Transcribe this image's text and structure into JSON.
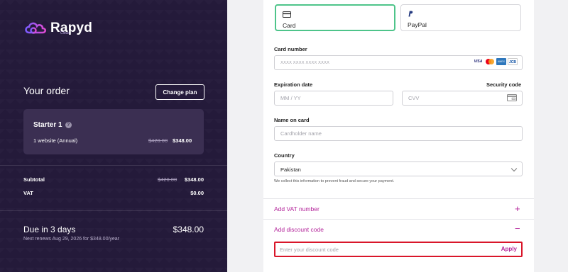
{
  "brand": {
    "name": "Rapyd",
    "sub": "Cloud"
  },
  "order": {
    "title": "Your order",
    "change_plan_label": "Change plan",
    "plan": {
      "name": "Starter 1",
      "description": "1 website (Annual)",
      "old_price": "$420.00",
      "new_price": "$348.00"
    },
    "subtotal": {
      "label": "Subtotal",
      "old": "$420.00",
      "new": "$348.00"
    },
    "vat": {
      "label": "VAT",
      "value": "$0.00"
    },
    "due": {
      "title": "Due in 3 days",
      "amount": "$348.00",
      "note": "Next renews Aug 29, 2026 for $348.00/year"
    }
  },
  "payment": {
    "tabs": [
      {
        "label": "Card",
        "active": true
      },
      {
        "label": "PayPal",
        "active": false
      }
    ],
    "card_number": {
      "label": "Card number",
      "placeholder": "XXXX XXXX XXXX XXXX"
    },
    "card_brands": [
      "VISA",
      "MC",
      "AMEX",
      "JCB"
    ],
    "expiration": {
      "label": "Expiration date",
      "placeholder": "MM / YY"
    },
    "security": {
      "label": "Security code",
      "placeholder": "CVV"
    },
    "name": {
      "label": "Name on card",
      "placeholder": "Cardholder name"
    },
    "country": {
      "label": "Country",
      "value": "Pakistan",
      "note": "We collect this information to prevent fraud and secure your payment."
    },
    "vat_link": "Add VAT number",
    "discount_link": "Add discount code",
    "discount": {
      "placeholder": "Enter your discount code",
      "apply_label": "Apply"
    }
  },
  "colors": {
    "accent": "#b3249a",
    "active_tab": "#4ec48a",
    "highlight": "#d9162a",
    "panel": "#241a3a"
  }
}
